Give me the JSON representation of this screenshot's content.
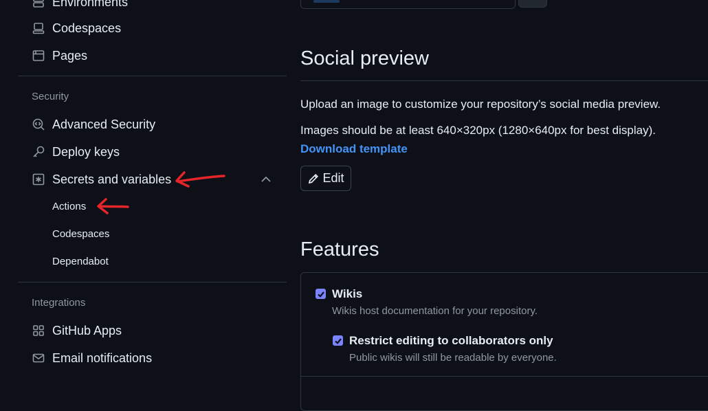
{
  "sidebar": {
    "top_items": [
      {
        "label": "Environments",
        "icon": "server-icon"
      },
      {
        "label": "Codespaces",
        "icon": "codespaces-icon"
      },
      {
        "label": "Pages",
        "icon": "browser-icon"
      }
    ],
    "security": {
      "title": "Security",
      "items": [
        {
          "label": "Advanced Security",
          "icon": "codescan-icon"
        },
        {
          "label": "Deploy keys",
          "icon": "key-icon"
        },
        {
          "label": "Secrets and variables",
          "icon": "asterisk-icon"
        }
      ],
      "sub_items": [
        "Actions",
        "Codespaces",
        "Dependabot"
      ]
    },
    "integrations": {
      "title": "Integrations",
      "items": [
        {
          "label": "GitHub Apps",
          "icon": "apps-icon"
        },
        {
          "label": "Email notifications",
          "icon": "mail-icon"
        }
      ]
    }
  },
  "main": {
    "social_preview": {
      "heading": "Social preview",
      "description": "Upload an image to customize your repository’s social media preview.",
      "size_note": "Images should be at least 640×320px (1280×640px for best display).",
      "download_link": "Download template",
      "edit_label": "Edit"
    },
    "features": {
      "heading": "Features",
      "wikis": {
        "label": "Wikis",
        "description": "Wikis host documentation for your repository.",
        "checked": true
      },
      "restrict_editing": {
        "label": "Restrict editing to collaborators only",
        "description": "Public wikis will still be readable by everyone.",
        "checked": true
      }
    }
  },
  "colors": {
    "background": "#0d1117",
    "text": "#e6edf3",
    "muted": "#9198a1",
    "border": "#30363d",
    "link": "#4493f8",
    "checkbox": "#7b83ff",
    "annotation": "#e5252a"
  }
}
